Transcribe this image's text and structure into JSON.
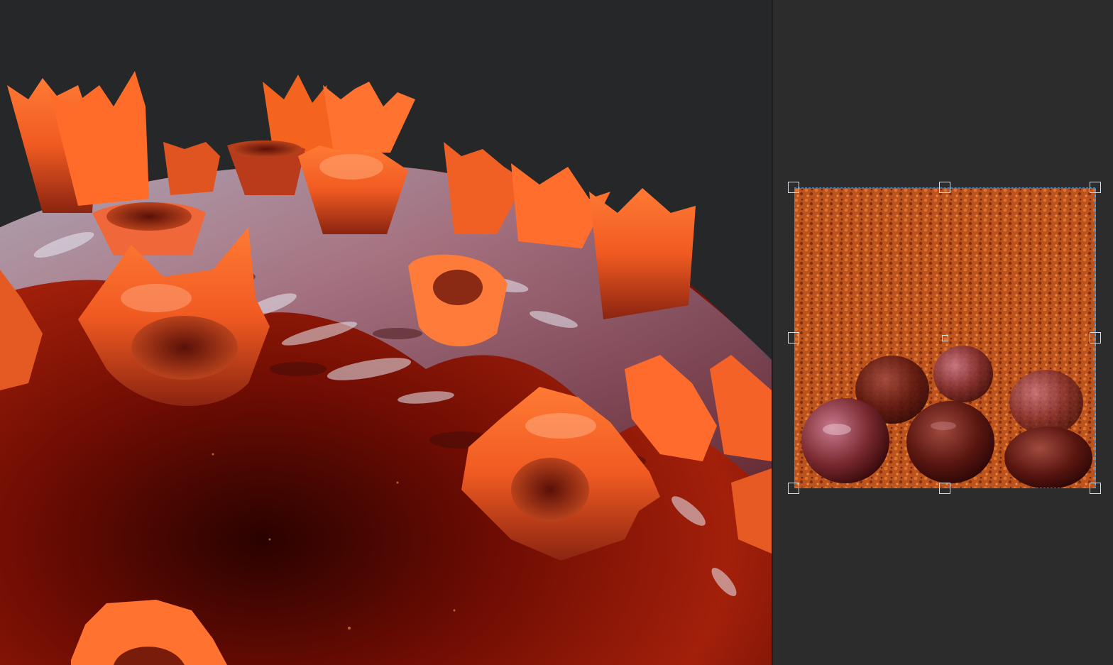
{
  "viewport": {
    "background": "#262729",
    "subject": "virus-particle-render",
    "colors": {
      "spike_orange": "#ff6a2a",
      "spike_highlight": "#ffb08a",
      "membrane_silver": "#9aa2b6",
      "membrane_pink": "#c77d8c",
      "core_red": "#7a0e04",
      "core_dark": "#2a0200"
    }
  },
  "texture_panel": {
    "background": "#2c2c2d",
    "selection_color": "#3f86c9",
    "handle_color": "#d9dde2",
    "handles": [
      "top-left",
      "top-center",
      "top-right",
      "middle-left",
      "middle-right",
      "bottom-left",
      "bottom-center",
      "bottom-right"
    ],
    "pivot": "center"
  }
}
